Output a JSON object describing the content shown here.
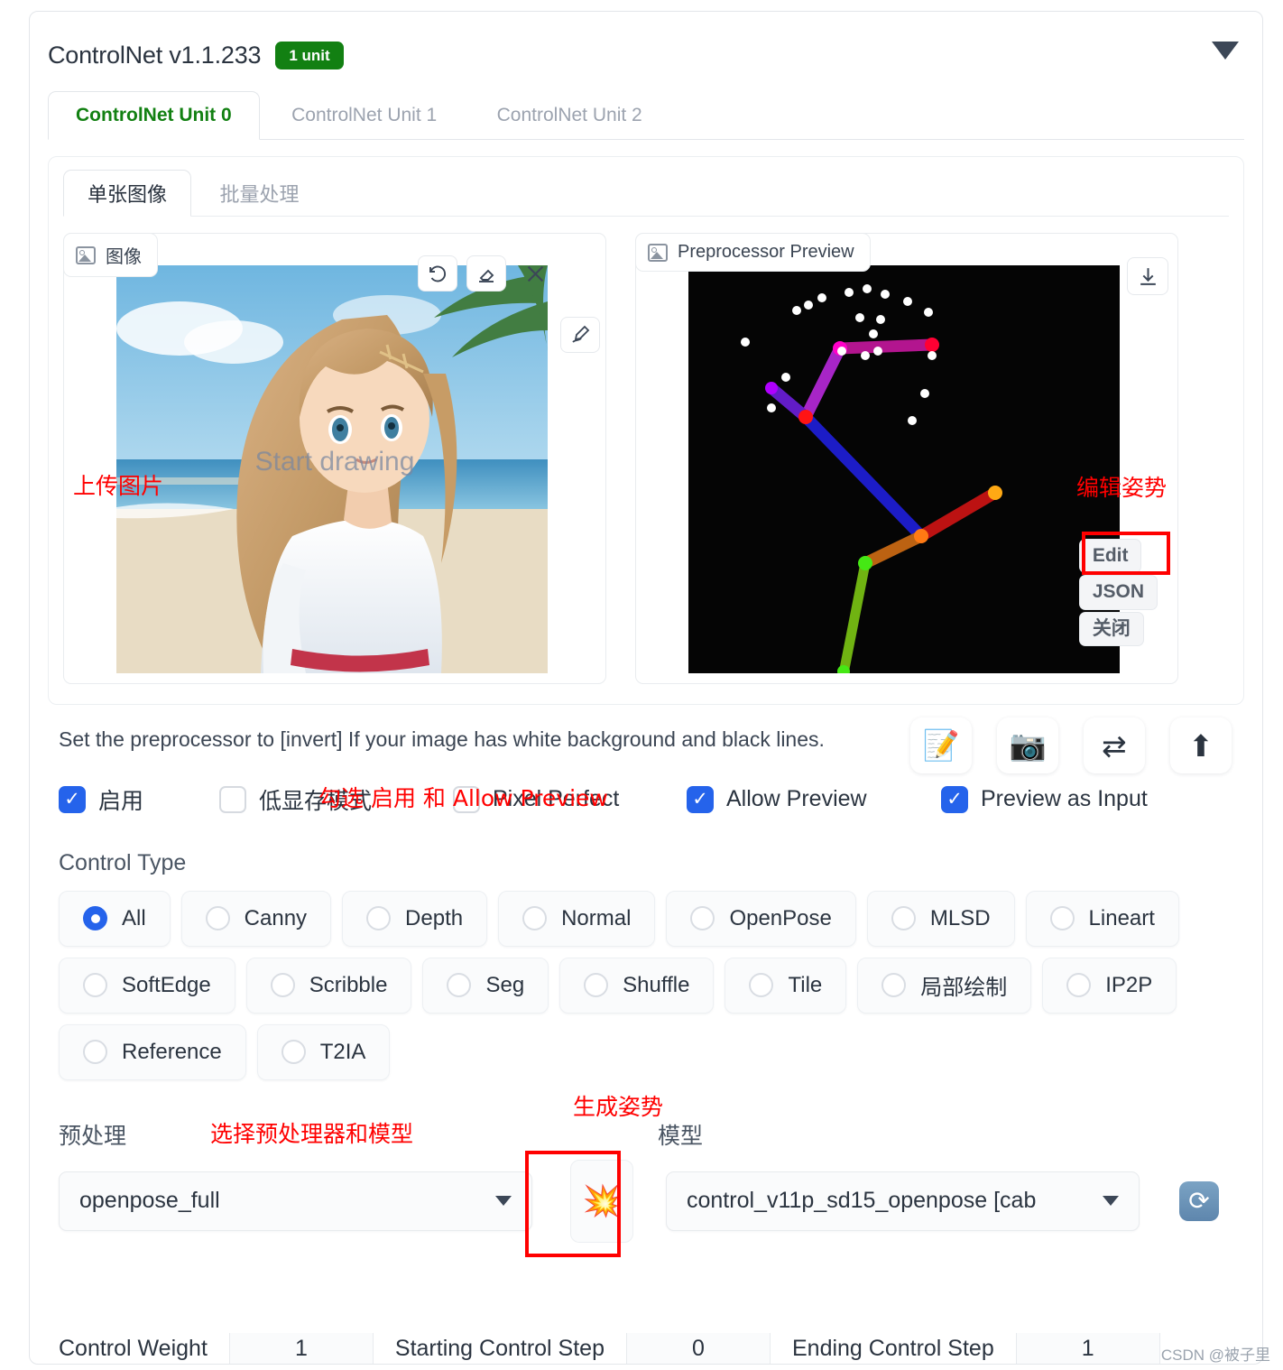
{
  "header": {
    "title": "ControlNet v1.1.233",
    "badge": "1 unit",
    "collapse_icon": "triangle-down-icon"
  },
  "unit_tabs": [
    {
      "label": "ControlNet Unit 0",
      "active": true
    },
    {
      "label": "ControlNet Unit 1",
      "active": false
    },
    {
      "label": "ControlNet Unit 2",
      "active": false
    }
  ],
  "inner_tabs": [
    {
      "label": "单张图像",
      "active": true
    },
    {
      "label": "批量处理",
      "active": false
    }
  ],
  "image_pane": {
    "label": "图像",
    "watermark": "Start drawing",
    "annotation": "上传图片",
    "tools": [
      "undo-icon",
      "eraser-icon",
      "close-icon",
      "draw-icon"
    ]
  },
  "preview_pane": {
    "label": "Preprocessor Preview",
    "annotation": "编辑姿势",
    "download_icon": "download-icon",
    "buttons": [
      {
        "label": "Edit",
        "highlighted": true
      },
      {
        "label": "JSON",
        "highlighted": false
      },
      {
        "label": "关闭",
        "highlighted": false
      }
    ]
  },
  "instruction": "Set the preprocessor to [invert] If your image has white background and black lines.",
  "instruction_annotation": "勾选 启用 和 Allow Preview",
  "toolbar_icons": [
    {
      "name": "memo-pencil-icon",
      "glyph": "📝"
    },
    {
      "name": "camera-icon",
      "glyph": "📷"
    },
    {
      "name": "swap-icon",
      "glyph": "⇄"
    },
    {
      "name": "upload-arrow-icon",
      "glyph": "⬆"
    }
  ],
  "checkboxes": [
    {
      "label": "启用",
      "checked": true
    },
    {
      "label": "低显存模式",
      "checked": false
    },
    {
      "label": "Pixel Perfect",
      "checked": false
    },
    {
      "label": "Allow Preview",
      "checked": true
    },
    {
      "label": "Preview as Input",
      "checked": true
    }
  ],
  "control_type": {
    "title": "Control Type",
    "options": [
      {
        "label": "All",
        "selected": true
      },
      {
        "label": "Canny",
        "selected": false
      },
      {
        "label": "Depth",
        "selected": false
      },
      {
        "label": "Normal",
        "selected": false
      },
      {
        "label": "OpenPose",
        "selected": false
      },
      {
        "label": "MLSD",
        "selected": false
      },
      {
        "label": "Lineart",
        "selected": false
      },
      {
        "label": "SoftEdge",
        "selected": false
      },
      {
        "label": "Scribble",
        "selected": false
      },
      {
        "label": "Seg",
        "selected": false
      },
      {
        "label": "Shuffle",
        "selected": false
      },
      {
        "label": "Tile",
        "selected": false
      },
      {
        "label": "局部绘制",
        "selected": false
      },
      {
        "label": "IP2P",
        "selected": false
      },
      {
        "label": "Reference",
        "selected": false
      },
      {
        "label": "T2IA",
        "selected": false
      }
    ]
  },
  "preprocessor": {
    "label": "预处理",
    "value": "openpose_full",
    "annotation": "选择预处理器和模型"
  },
  "model": {
    "label": "模型",
    "value": "control_v11p_sd15_openpose [cab",
    "refresh_icon": "refresh-icon"
  },
  "run_button": {
    "glyph": "💥",
    "annotation": "生成姿势",
    "highlighted": true
  },
  "bottom_row": {
    "control_weight_label": "Control Weight",
    "control_weight_value": "1",
    "starting_step_label": "Starting Control Step",
    "starting_step_value": "0",
    "ending_step_label": "Ending Control Step",
    "ending_step_value": "1"
  },
  "watermark": "CSDN @被子里",
  "colors": {
    "accent_green": "#128012",
    "accent_blue": "#2563eb",
    "annotation_red": "#ff0000"
  }
}
